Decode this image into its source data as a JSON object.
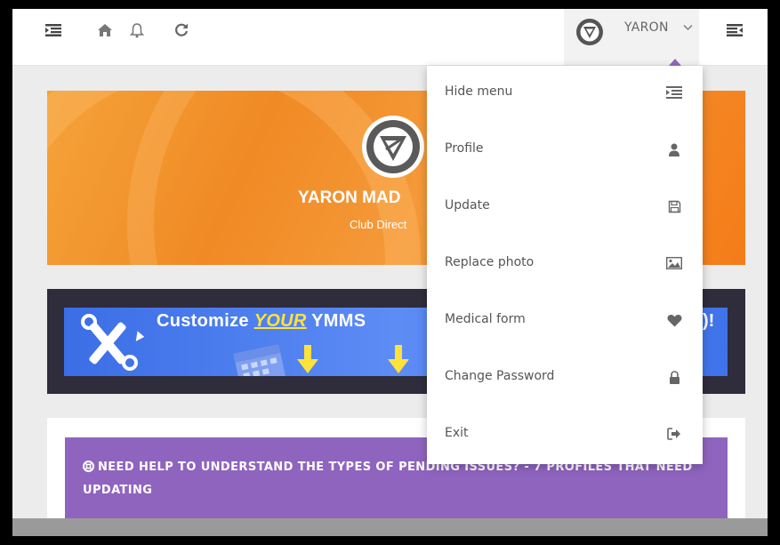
{
  "topbar": {
    "user_name": "YARON",
    "icons": [
      "menu-toggle-icon",
      "home-icon",
      "bell-icon",
      "refresh-icon",
      "chevron-down-icon",
      "sidebar-toggle-icon"
    ]
  },
  "banner": {
    "name": "YARON MAD",
    "role": "Club Direct"
  },
  "promo": {
    "prefix": "Customize ",
    "highlight": "YOUR",
    "suffix": " YMMS",
    "tail": ")!"
  },
  "notice": {
    "text": "NEED HELP TO UNDERSTAND THE TYPES OF PENDING ISSUES? - 7 PROFILES THAT NEED UPDATING"
  },
  "user_menu": {
    "items": [
      {
        "label": "Hide menu",
        "icon": "hide-menu-icon"
      },
      {
        "label": "Profile",
        "icon": "user-icon"
      },
      {
        "label": "Update",
        "icon": "save-icon"
      },
      {
        "label": "Replace photo",
        "icon": "image-icon"
      },
      {
        "label": "Medical form",
        "icon": "heart-icon"
      },
      {
        "label": "Change Password",
        "icon": "lock-icon"
      },
      {
        "label": "Exit",
        "icon": "sign-out-icon"
      }
    ]
  },
  "colors": {
    "accent_purple": "#8f64bf",
    "banner_orange": "#f08a24",
    "promo_blue": "#3b6ee6",
    "promo_frame": "#2f2c3c"
  }
}
